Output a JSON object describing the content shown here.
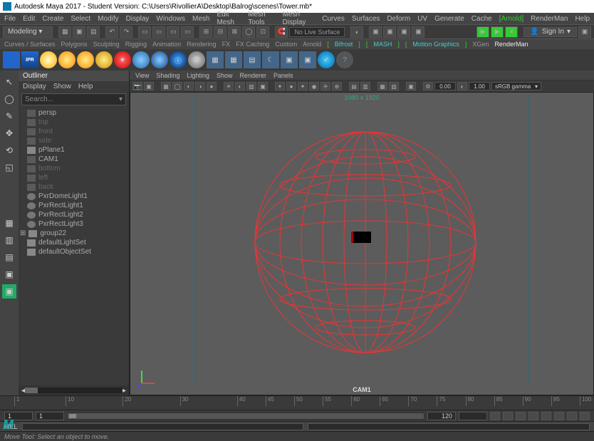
{
  "title": "Autodesk Maya 2017 - Student Version: C:\\Users\\RivollierA\\Desktop\\Balrog\\scenes\\Tower.mb*",
  "main_menu": [
    "File",
    "Edit",
    "Create",
    "Select",
    "Modify",
    "Display",
    "Windows",
    "Mesh",
    "Edit Mesh",
    "Mesh Tools",
    "Mesh Display",
    "Curves",
    "Surfaces",
    "Deform",
    "UV",
    "Generate",
    "Cache"
  ],
  "main_menu_arnold": "[Arnold]",
  "main_menu_tail": [
    "RenderMan",
    "Help"
  ],
  "mode_select": "Modeling",
  "no_live_surface": "No Live Surface",
  "signin": "Sign In",
  "shelf_tabs": [
    "Curves / Surfaces",
    "Polygons",
    "Sculpting",
    "Rigging",
    "Animation",
    "Rendering",
    "FX",
    "FX Caching",
    "Custom",
    "Arnold"
  ],
  "shelf_tabs_bracket": [
    "Bifrost",
    "MASH",
    "Motion Graphics"
  ],
  "shelf_tabs_tail": [
    "XGen",
    "RenderMan"
  ],
  "outliner": {
    "title": "Outliner",
    "menu": [
      "Display",
      "Show",
      "Help"
    ],
    "search_placeholder": "Search...",
    "items": [
      {
        "label": "persp",
        "dim": false,
        "type": "cam"
      },
      {
        "label": "top",
        "dim": true,
        "type": "cam"
      },
      {
        "label": "front",
        "dim": true,
        "type": "cam"
      },
      {
        "label": "side",
        "dim": true,
        "type": "cam"
      },
      {
        "label": "pPlane1",
        "dim": false,
        "type": "mesh"
      },
      {
        "label": "CAM1",
        "dim": false,
        "type": "cam"
      },
      {
        "label": "bottom",
        "dim": true,
        "type": "cam"
      },
      {
        "label": "left",
        "dim": true,
        "type": "cam"
      },
      {
        "label": "back",
        "dim": true,
        "type": "cam"
      },
      {
        "label": "PxrDomeLight1",
        "dim": false,
        "type": "light"
      },
      {
        "label": "PxrRectLight1",
        "dim": false,
        "type": "light"
      },
      {
        "label": "PxrRectLight2",
        "dim": false,
        "type": "light"
      },
      {
        "label": "PxrRectLight3",
        "dim": false,
        "type": "light"
      },
      {
        "label": "group22",
        "dim": false,
        "type": "group"
      },
      {
        "label": "defaultLightSet",
        "dim": false,
        "type": "set"
      },
      {
        "label": "defaultObjectSet",
        "dim": false,
        "type": "set"
      }
    ]
  },
  "viewport": {
    "menu": [
      "View",
      "Shading",
      "Lighting",
      "Show",
      "Renderer",
      "Panels"
    ],
    "num1": "0.00",
    "num2": "1.00",
    "gamma_select": "sRGB gamma",
    "resolution_gate": "1080 x 1920",
    "camera_label": "CAM1"
  },
  "timeline": {
    "ticks": [
      1,
      10,
      20,
      30,
      40,
      45,
      50,
      55,
      60,
      65,
      70,
      75,
      80,
      85,
      90,
      95,
      100
    ],
    "start": "1",
    "range_start": "1",
    "range_end": "120",
    "end": ""
  },
  "mel_label": "MEL",
  "status_text": "Move Tool: Select an object to move."
}
